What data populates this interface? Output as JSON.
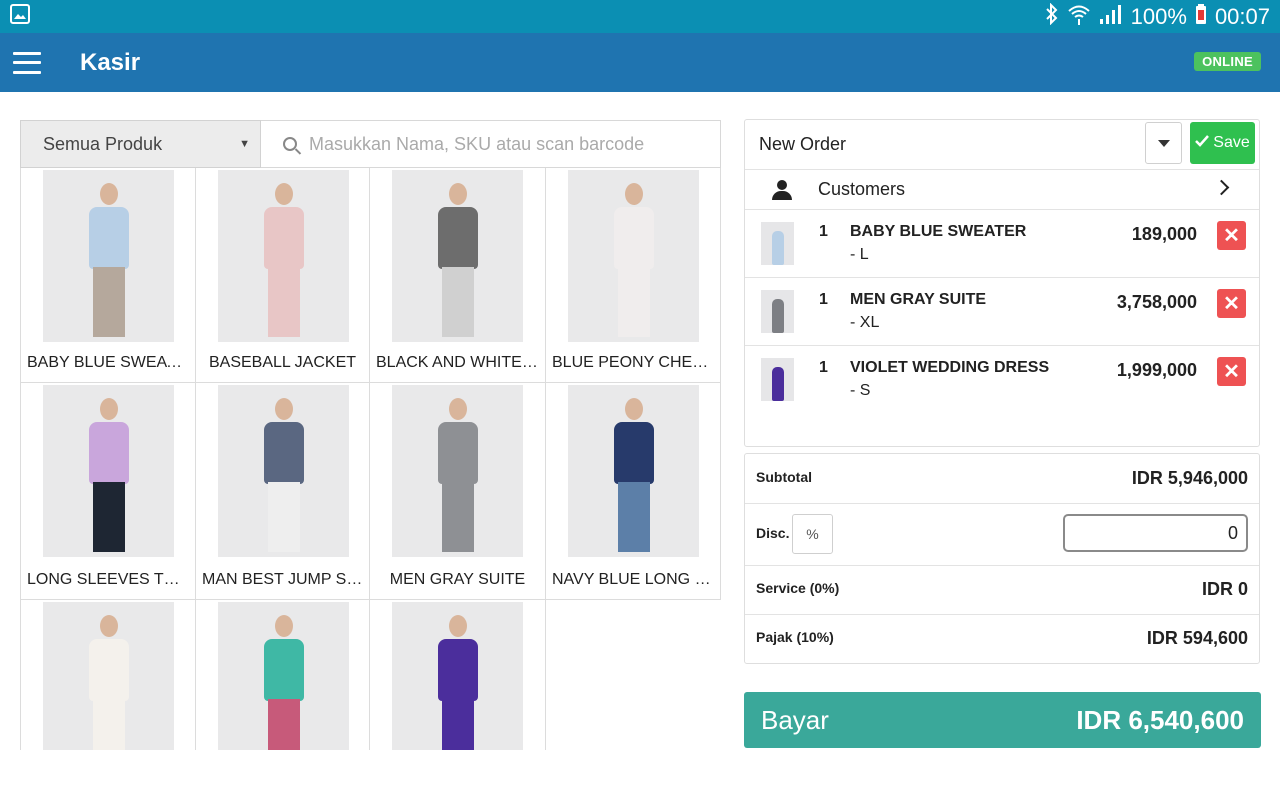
{
  "status_bar": {
    "battery": "100%",
    "time": "00:07",
    "icons": [
      "image-icon",
      "bluetooth-icon",
      "wifi-icon",
      "signal-icon",
      "battery-icon"
    ]
  },
  "app_bar": {
    "title": "Kasir",
    "status_badge": "ONLINE"
  },
  "filter": {
    "category": "Semua Produk",
    "search_placeholder": "Masukkan Nama, SKU atau scan barcode"
  },
  "products": [
    {
      "name": "BABY BLUE SWEATER",
      "torso": "#b7cfe6",
      "legs": "#b5a89c"
    },
    {
      "name": "BASEBALL JACKET",
      "torso": "#e8c6c6",
      "legs": "#e8c6c6"
    },
    {
      "name": "BLACK AND WHITE ...",
      "torso": "#6d6d6d",
      "legs": "#d0d0d0"
    },
    {
      "name": "BLUE PEONY CHEO...",
      "torso": "#f0eded",
      "legs": "#f0eded"
    },
    {
      "name": "LONG SLEEVES TSHI...",
      "torso": "#c9a6dc",
      "legs": "#1e2633"
    },
    {
      "name": "MAN BEST JUMP SU...",
      "torso": "#5a6781",
      "legs": "#eeeeee"
    },
    {
      "name": "MEN GRAY SUITE",
      "torso": "#8e9094",
      "legs": "#8e9094"
    },
    {
      "name": "NAVY BLUE LONG S...",
      "torso": "#273a6b",
      "legs": "#5c7fa8"
    },
    {
      "name": "",
      "torso": "#f4f1ec",
      "legs": "#f4f1ec"
    },
    {
      "name": "",
      "torso": "#3fb8a5",
      "legs": "#c75a7a"
    },
    {
      "name": "",
      "torso": "#4b2e9c",
      "legs": "#4b2e9c"
    }
  ],
  "order": {
    "title": "New Order",
    "save_label": "Save",
    "customers_label": "Customers",
    "items": [
      {
        "qty": "1",
        "name": "BABY BLUE SWEATER",
        "variant": "- L",
        "price": "189,000",
        "color": "#b7cfe6"
      },
      {
        "qty": "1",
        "name": "MEN GRAY SUITE",
        "variant": "- XL",
        "price": "3,758,000",
        "color": "#7d7f84"
      },
      {
        "qty": "1",
        "name": "VIOLET WEDDING DRESS",
        "variant": "- S",
        "price": "1,999,000",
        "color": "#4b2e9c"
      }
    ]
  },
  "totals": {
    "subtotal_label": "Subtotal",
    "subtotal_value": "IDR 5,946,000",
    "disc_label": "Disc.",
    "disc_unit": "%",
    "disc_value": "0",
    "service_label": "Service (0%)",
    "service_value": "IDR 0",
    "tax_label": "Pajak (10%)",
    "tax_value": "IDR 594,600"
  },
  "pay": {
    "label": "Bayar",
    "value": "IDR 6,540,600"
  },
  "colors": {
    "status_bar": "#0b8fb3",
    "app_bar": "#1f74b0",
    "online": "#4cc25e",
    "save": "#2fc04f",
    "delete": "#ee5253",
    "pay": "#3aa89a"
  }
}
